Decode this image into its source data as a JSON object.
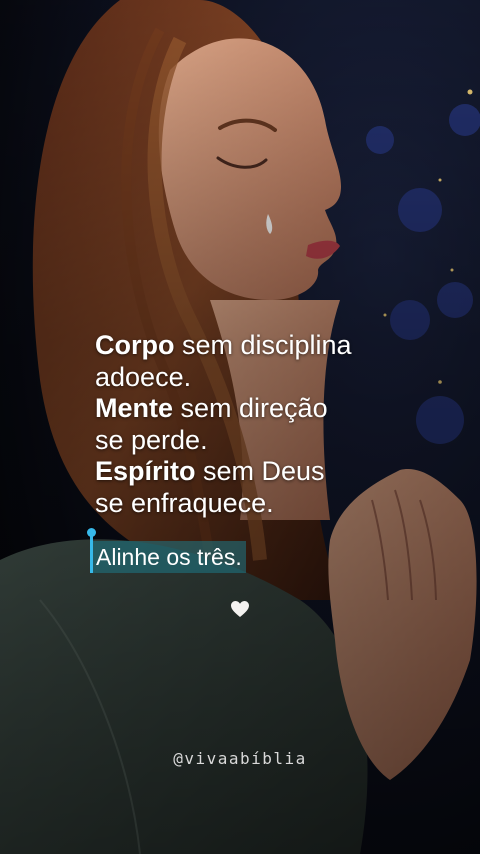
{
  "quote": {
    "line1_bold": "Corpo",
    "line1_rest": " sem disciplina",
    "line2": "adoece.",
    "line3_bold": "Mente",
    "line3_rest": " sem direção",
    "line4": "se perde.",
    "line5_bold": "Espírito",
    "line5_rest": " sem Deus",
    "line6": "se enfraquece."
  },
  "cta": "Alinhe os três.",
  "heart_icon": "white-heart-icon",
  "handle": "@vivaabíblia",
  "colors": {
    "text": "#ffffff",
    "cta_highlight": "#1e7887",
    "caret": "#37b9ea"
  }
}
